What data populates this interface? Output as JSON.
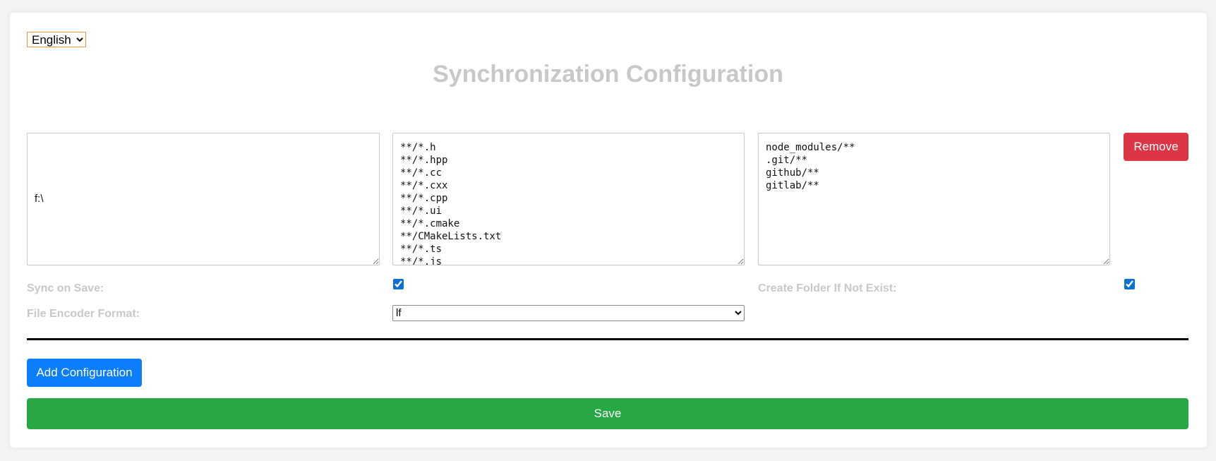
{
  "language": {
    "selected": "English"
  },
  "title": "Synchronization Configuration",
  "config": {
    "path_value": "f:\\",
    "include_patterns": "**/*.h\n**/*.hpp\n**/*.cc\n**/*.cxx\n**/*.cpp\n**/*.ui\n**/*.cmake\n**/CMakeLists.txt\n**/*.ts\n**/*.js",
    "exclude_patterns": "node_modules/**\n.git/**\ngithub/**\ngitlab/**",
    "remove_label": "Remove",
    "sync_on_save_label": "Sync on Save:",
    "sync_on_save_checked": true,
    "create_folder_label": "Create Folder If Not Exist:",
    "create_folder_checked": true,
    "encoder_label": "File Encoder Format:",
    "encoder_value": "lf"
  },
  "add_label": "Add Configuration",
  "save_label": "Save",
  "colors": {
    "remove_button": "#dc3545",
    "add_button": "#0b7dfd",
    "save_button": "#28a745",
    "muted_text": "#c8c8c8"
  }
}
